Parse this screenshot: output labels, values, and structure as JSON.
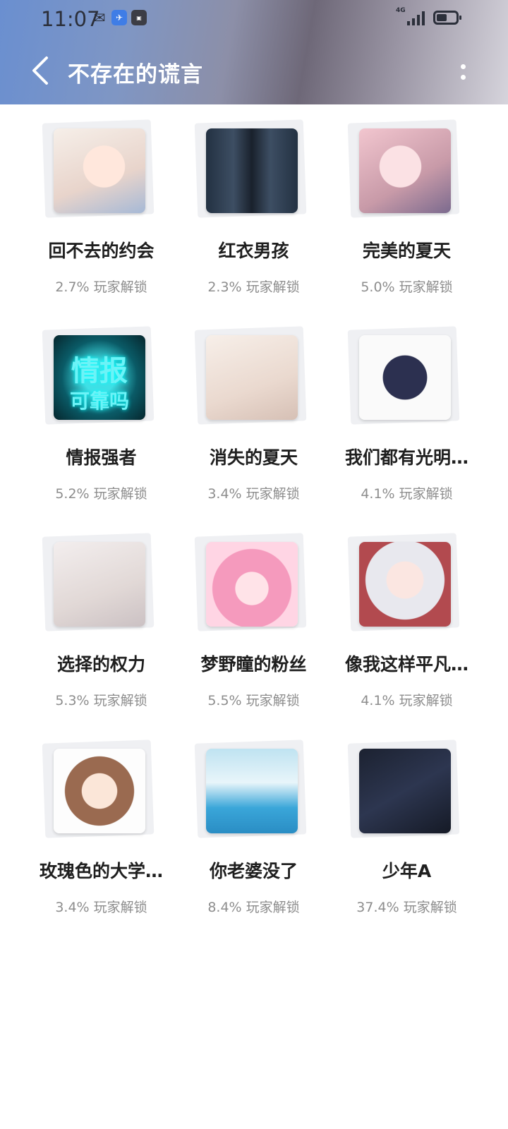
{
  "status_bar": {
    "time": "11:07",
    "network": "4G"
  },
  "header": {
    "title": "不存在的谎言"
  },
  "items": [
    {
      "title": "回不去的约会",
      "unlock": "2.7% 玩家解锁"
    },
    {
      "title": "红衣男孩",
      "unlock": "2.3% 玩家解锁"
    },
    {
      "title": "完美的夏天",
      "unlock": "5.0% 玩家解锁"
    },
    {
      "title": "情报强者",
      "unlock": "5.2% 玩家解锁",
      "thumb_text_1": "情报",
      "thumb_text_2": "可靠吗"
    },
    {
      "title": "消失的夏天",
      "unlock": "3.4% 玩家解锁"
    },
    {
      "title": "我们都有光明…",
      "unlock": "4.1% 玩家解锁"
    },
    {
      "title": "选择的权力",
      "unlock": "5.3% 玩家解锁"
    },
    {
      "title": "梦野瞳的粉丝",
      "unlock": "5.5% 玩家解锁"
    },
    {
      "title": "像我这样平凡…",
      "unlock": "4.1% 玩家解锁"
    },
    {
      "title": "玫瑰色的大学…",
      "unlock": "3.4% 玩家解锁"
    },
    {
      "title": "你老婆没了",
      "unlock": "8.4% 玩家解锁"
    },
    {
      "title": "少年A",
      "unlock": "37.4% 玩家解锁"
    }
  ]
}
